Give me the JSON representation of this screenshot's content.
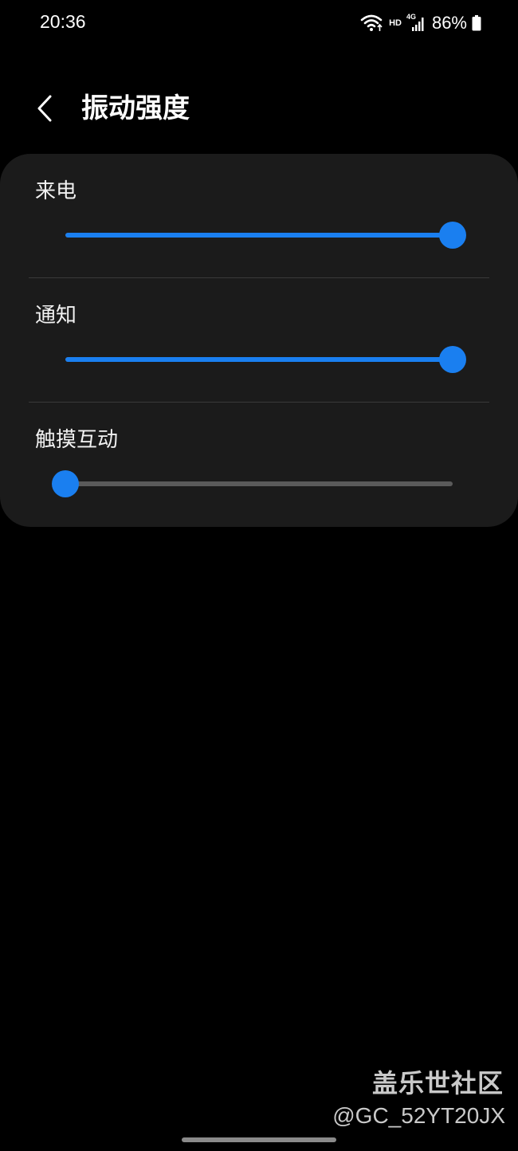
{
  "status_bar": {
    "time": "20:36",
    "hd_label": "HD",
    "network_type": "4G",
    "battery_text": "86%",
    "icons": [
      "wifi-icon",
      "signal-icon",
      "battery-icon"
    ]
  },
  "header": {
    "back_icon": "chevron-left-icon",
    "title": "振动强度"
  },
  "settings": [
    {
      "label": "来电",
      "value": 1.0
    },
    {
      "label": "通知",
      "value": 1.0
    },
    {
      "label": "触摸互动",
      "value": 0.0
    }
  ],
  "colors": {
    "accent": "#1a7ff0",
    "card_background": "#1b1b1b",
    "page_background": "#000000",
    "track_inactive": "#5a5a5a"
  },
  "watermark": {
    "title": "盖乐世社区",
    "user": "@GC_52YT20JX"
  }
}
